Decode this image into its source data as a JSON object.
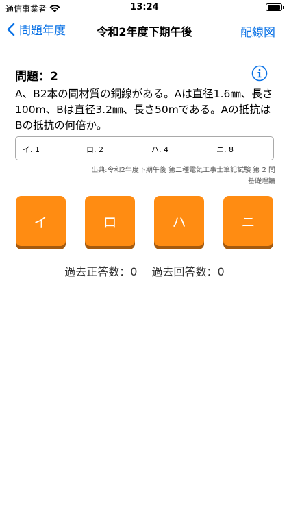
{
  "status": {
    "carrier": "通信事業者",
    "time": "13:24"
  },
  "nav": {
    "back_label": "問題年度",
    "title": "令和2年度下期午後",
    "right_label": "配線図"
  },
  "question": {
    "number": "問題：2",
    "text": "A、B2本の同材質の銅線がある。Aは直径1.6㎜、長さ100m、Bは直径3.2㎜、長さ50mである。Aの抵抗はBの抵抗の何倍か。"
  },
  "choices": [
    "イ. 1",
    "ロ. 2",
    "ハ. 4",
    "ニ. 8"
  ],
  "source": {
    "line1": "出典:令和2年度下期午後 第二種電気工事士筆記試験 第 2 問",
    "line2": "基礎理論"
  },
  "answers": [
    "イ",
    "ロ",
    "ハ",
    "ニ"
  ],
  "stats": {
    "correct": "過去正答数：0",
    "answered": "過去回答数：0"
  },
  "colors": {
    "accent": "#0a72e6",
    "button": "#ff8c12",
    "button_shadow": "#a55a0e"
  }
}
